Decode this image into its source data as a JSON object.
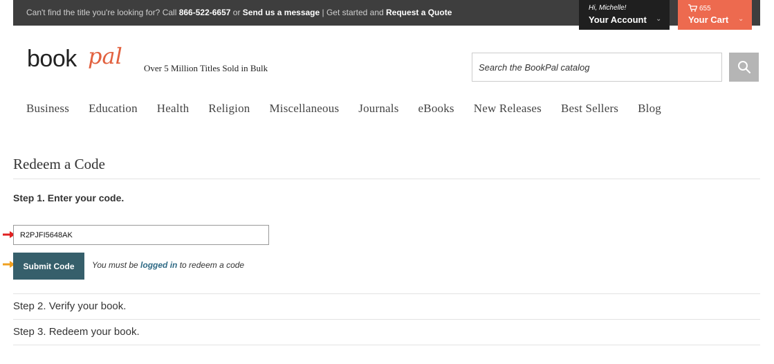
{
  "topbar": {
    "msg_prefix": "Can't find the title you're looking for? Call ",
    "phone": "866-522-6657",
    "msg_or": " or ",
    "send_message": "Send us a message",
    "msg_sep": " | Get started and ",
    "request_quote": "Request a Quote",
    "account_greeting": "Hi, Michelle!",
    "account_label": "Your Account",
    "cart_count": "655",
    "cart_label": "Your Cart"
  },
  "header": {
    "logo_book": "book",
    "logo_pal": "pal",
    "tagline": "Over 5 Million Titles Sold in Bulk",
    "search_placeholder": "Search the BookPal catalog"
  },
  "nav": [
    "Business",
    "Education",
    "Health",
    "Religion",
    "Miscellaneous",
    "Journals",
    "eBooks",
    "New Releases",
    "Best Sellers",
    "Blog"
  ],
  "main": {
    "title": "Redeem a Code",
    "step1": "Step 1. Enter your code.",
    "code_value": "R2PJFI5648AK",
    "submit_label": "Submit Code",
    "note_prefix": "You must be ",
    "note_link": "logged in",
    "note_suffix": " to redeem a code",
    "step2": "Step 2. Verify your book.",
    "step3": "Step 3. Redeem your book."
  },
  "colors": {
    "topbar": "#3e3e3e",
    "account": "#1f1f1f",
    "cart": "#ed6a4f",
    "submit": "#365f6b",
    "logo_accent": "#e2613f",
    "arrow_red": "#e02020",
    "arrow_orange": "#f0a020"
  }
}
